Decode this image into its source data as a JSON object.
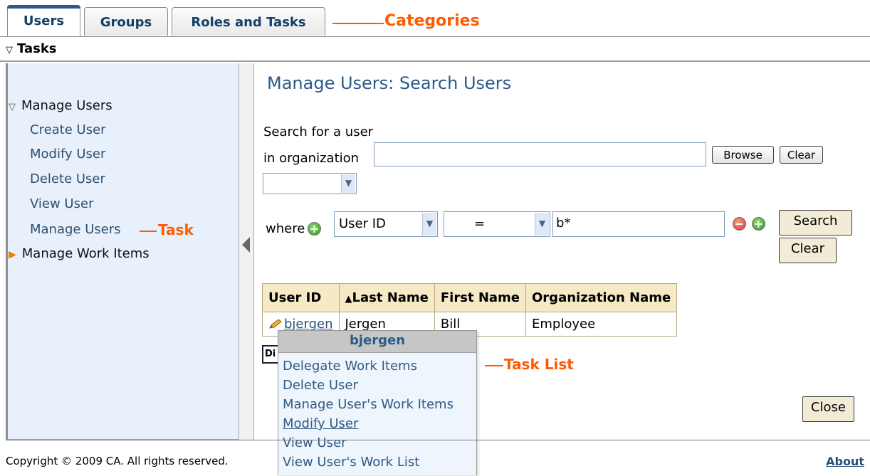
{
  "tabs": [
    {
      "label": "Users",
      "active": true
    },
    {
      "label": "Groups",
      "active": false
    },
    {
      "label": "Roles and Tasks",
      "active": false
    }
  ],
  "annotations": {
    "categories": "Categories",
    "task": "Task",
    "task_list": "Task List"
  },
  "tasks_header": "Tasks",
  "sidebar": {
    "group_open": "Manage Users",
    "items": [
      "Create User",
      "Modify User",
      "Delete User",
      "View User",
      "Manage Users"
    ],
    "group_closed": "Manage Work Items"
  },
  "main": {
    "title": "Manage Users: Search Users",
    "search_label_1": "Search for a user",
    "search_label_2": "in organization",
    "org_value": "",
    "browse_label": "Browse",
    "clear_small_label": "Clear",
    "scope_value": "",
    "where_label": "where",
    "attribute_value": "User ID",
    "operator_value": "=",
    "criteria_value": "b*",
    "search_button": "Search",
    "clear_button": "Clear",
    "close_button": "Close"
  },
  "table": {
    "columns": [
      "User ID",
      "Last Name",
      "First Name",
      "Organization Name"
    ],
    "sort_indicator": "▲",
    "rows": [
      {
        "user_id": "bjergen",
        "last_name": "Jergen",
        "first_name": "Bill",
        "org": "Employee"
      }
    ],
    "small_box_text": "Di"
  },
  "popup": {
    "title": "bjergen",
    "items": [
      "Delegate Work Items",
      "Delete User",
      "Manage User's Work Items",
      "Modify User",
      "View User",
      "View User's Work List"
    ],
    "hover_index": 3
  },
  "footer": {
    "copyright": "Copyright © 2009 CA. All rights reserved.",
    "about": "About"
  },
  "colors": {
    "accent": "#2a5a8a",
    "annotation": "#ff5a00",
    "sidebar_bg": "#e8f1fb",
    "table_header_bg": "#f5e9c6"
  }
}
